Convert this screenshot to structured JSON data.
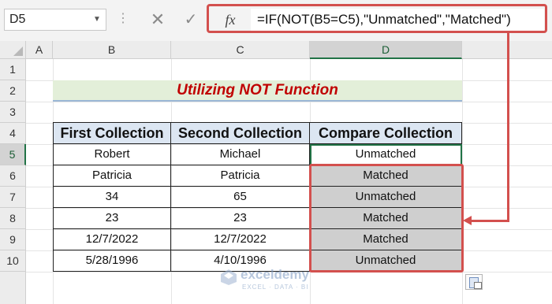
{
  "name_box": {
    "value": "D5"
  },
  "formula_bar": {
    "formula": "=IF(NOT(B5=C5),\"Unmatched\",\"Matched\")",
    "fx_label": "fx",
    "cancel_glyph": "✕",
    "enter_glyph": "✓"
  },
  "columns": [
    "A",
    "B",
    "C",
    "D"
  ],
  "rows": [
    "1",
    "2",
    "3",
    "4",
    "5",
    "6",
    "7",
    "8",
    "9",
    "10"
  ],
  "title": "Utilizing NOT Function",
  "table": {
    "headers": [
      "First Collection",
      "Second Collection",
      "Compare Collection"
    ],
    "rows": [
      [
        "Robert",
        "Michael",
        "Unmatched"
      ],
      [
        "Patricia",
        "Patricia",
        "Matched"
      ],
      [
        "34",
        "65",
        "Unmatched"
      ],
      [
        "23",
        "23",
        "Matched"
      ],
      [
        "12/7/2022",
        "12/7/2022",
        "Matched"
      ],
      [
        "5/28/1996",
        "4/10/1996",
        "Unmatched"
      ]
    ]
  },
  "watermark": {
    "name": "exceldemy",
    "tagline": "EXCEL · DATA · BI"
  },
  "colors": {
    "highlight": "#d3504e",
    "title_text": "#c00000",
    "title_bg": "#e3efd9",
    "header_bg": "#dce6f2",
    "selected_bg": "#cfcfcf",
    "active_green": "#217346"
  },
  "icons": {
    "cancel": "cancel-icon",
    "enter": "enter-icon",
    "function": "fx-icon",
    "dropdown": "chevron-down-icon",
    "paste_options": "paste-options-icon",
    "select_all": "select-all-icon"
  }
}
